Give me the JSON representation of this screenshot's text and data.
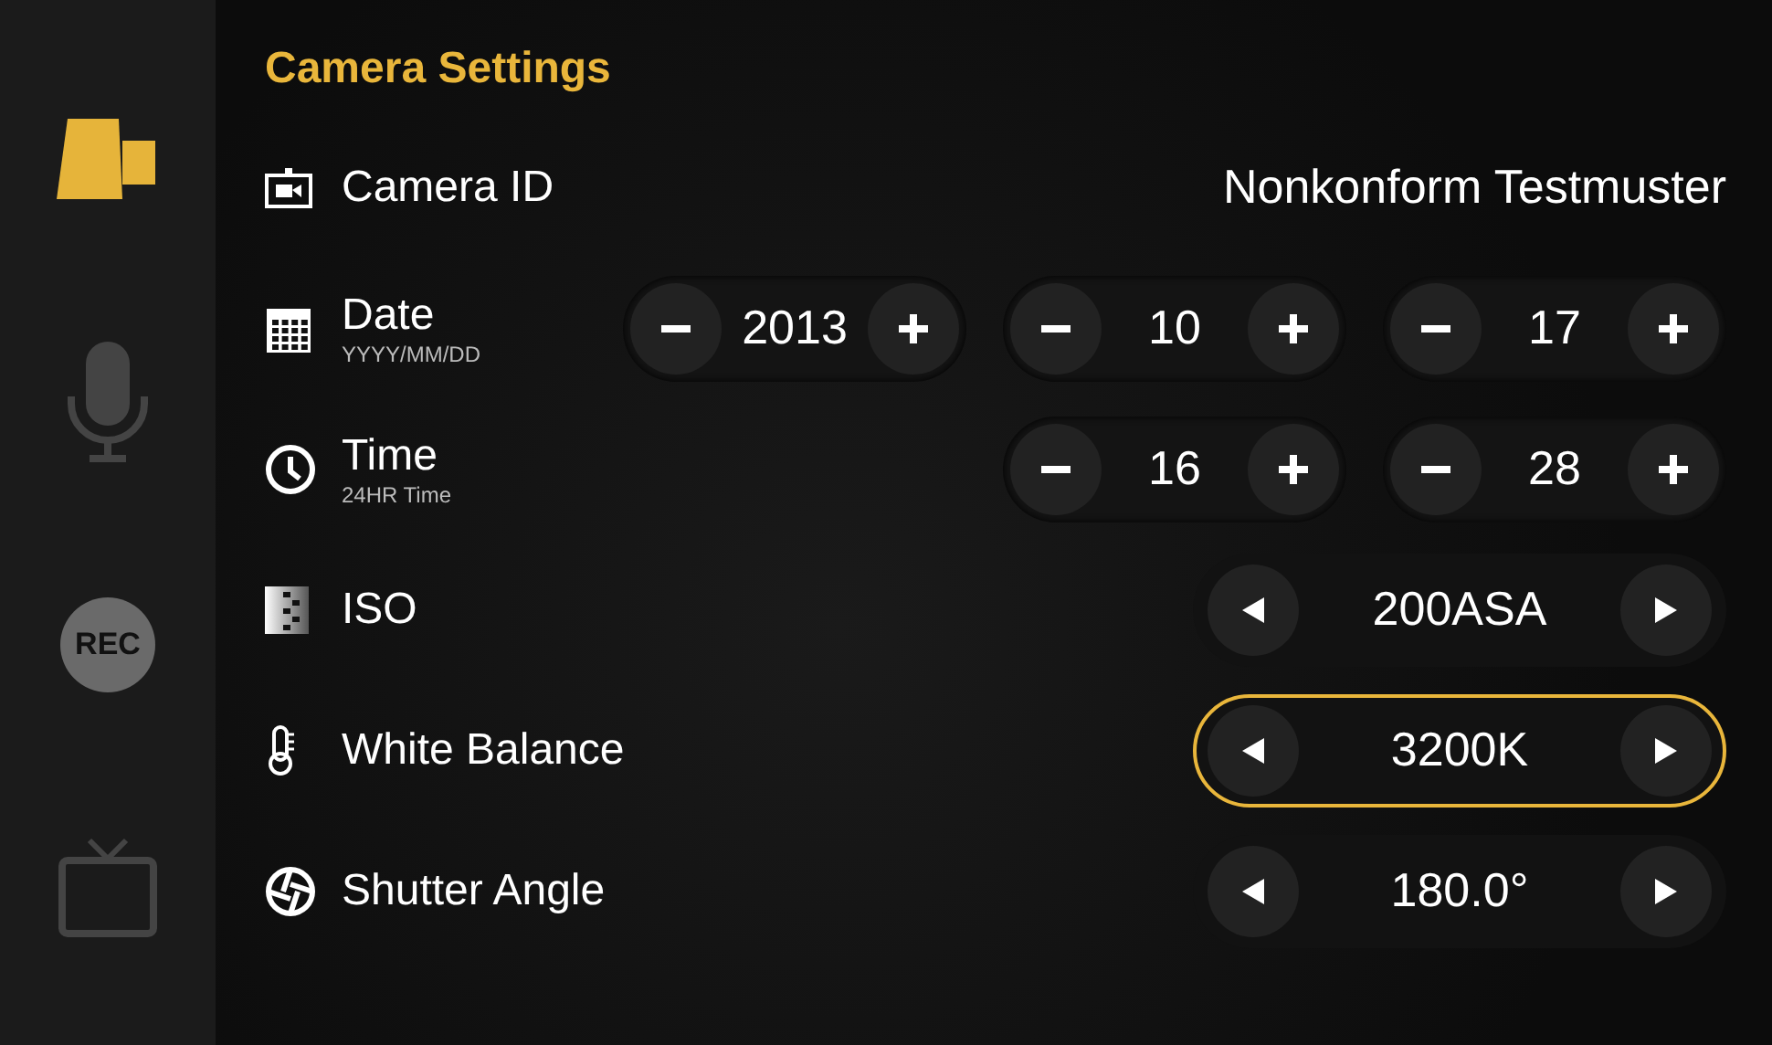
{
  "sidebar": {
    "items": [
      {
        "kind": "camera",
        "selected": true
      },
      {
        "kind": "microphone",
        "selected": false
      },
      {
        "kind": "record",
        "selected": false,
        "label": "REC"
      },
      {
        "kind": "monitor",
        "selected": false
      }
    ]
  },
  "title": "Camera Settings",
  "rows": [
    {
      "kind": "text",
      "label": "Camera ID",
      "value": "Nonkonform Testmuster"
    },
    {
      "kind": "steppers",
      "label": "Date",
      "sublabel": "YYYY/MM/DD",
      "steppers": [
        "2013",
        "10",
        "17"
      ]
    },
    {
      "kind": "steppers",
      "label": "Time",
      "sublabel": "24HR Time",
      "steppers": [
        "16",
        "28"
      ]
    },
    {
      "kind": "selector",
      "label": "ISO",
      "value": "200ASA",
      "selected": false
    },
    {
      "kind": "selector",
      "label": "White Balance",
      "value": "3200K",
      "selected": true
    },
    {
      "kind": "selector",
      "label": "Shutter Angle",
      "value": "180.0°",
      "selected": false
    }
  ]
}
